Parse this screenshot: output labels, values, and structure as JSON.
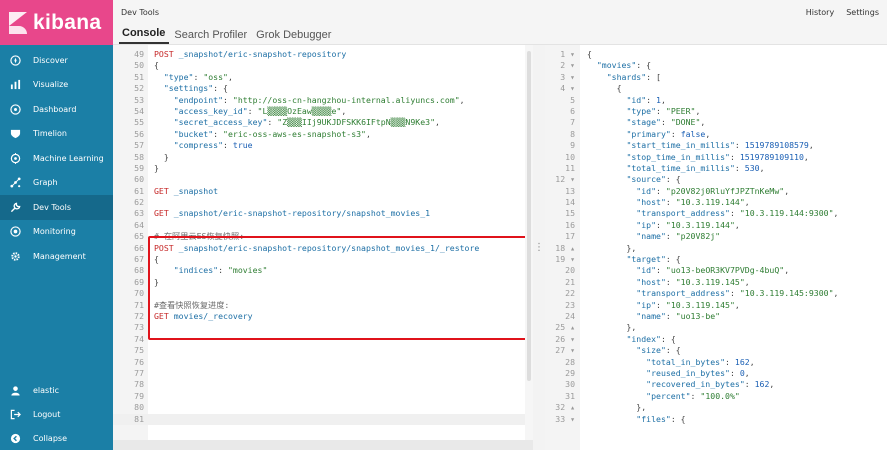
{
  "sidebar": {
    "brand": "kibana",
    "items": [
      {
        "label": "Discover",
        "icon": "compass-icon"
      },
      {
        "label": "Visualize",
        "icon": "bar-chart-icon"
      },
      {
        "label": "Dashboard",
        "icon": "dashboard-icon"
      },
      {
        "label": "Timelion",
        "icon": "shield-icon"
      },
      {
        "label": "Machine Learning",
        "icon": "machine-learning-icon"
      },
      {
        "label": "Graph",
        "icon": "graph-icon"
      },
      {
        "label": "Dev Tools",
        "icon": "wrench-icon"
      },
      {
        "label": "Monitoring",
        "icon": "monitoring-icon"
      },
      {
        "label": "Management",
        "icon": "gear-icon"
      }
    ],
    "bottom": [
      {
        "label": "elastic",
        "icon": "user-icon"
      },
      {
        "label": "Logout",
        "icon": "logout-icon"
      },
      {
        "label": "Collapse",
        "icon": "collapse-icon"
      }
    ]
  },
  "topbar": {
    "title": "Dev Tools",
    "history": "History",
    "settings": "Settings"
  },
  "tabs": [
    "Console",
    "Search Profiler",
    "Grok Debugger"
  ],
  "left_editor": {
    "lines": [
      {
        "n": "49",
        "t": "POST _snapshot/eric-snapshot-repository"
      },
      {
        "n": "50",
        "t": "{"
      },
      {
        "n": "51",
        "t": "  \"type\": \"oss\","
      },
      {
        "n": "52",
        "t": "  \"settings\": {"
      },
      {
        "n": "53",
        "t": "    \"endpoint\": \"http://oss-cn-hangzhou-internal.aliyuncs.com\","
      },
      {
        "n": "54",
        "t": "    \"access_key_id\": \"L▒▒▒▒OzEaw▒▒▒▒e\","
      },
      {
        "n": "55",
        "t": "    \"secret_access_key\": \"Z▒▒▒IIj9UKJDFSKK6IFtpN▒▒▒N9Ke3\","
      },
      {
        "n": "56",
        "t": "    \"bucket\": \"eric-oss-aws-es-snapshot-s3\","
      },
      {
        "n": "57",
        "t": "    \"compress\": true"
      },
      {
        "n": "58",
        "t": "  }"
      },
      {
        "n": "59",
        "t": "}"
      },
      {
        "n": "60",
        "t": ""
      },
      {
        "n": "61",
        "t": "GET _snapshot"
      },
      {
        "n": "62",
        "t": ""
      },
      {
        "n": "63",
        "t": "GET _snapshot/eric-snapshot-repository/snapshot_movies_1"
      },
      {
        "n": "64",
        "t": ""
      },
      {
        "n": "65",
        "t": "# 在阿里云ES恢复快照:"
      },
      {
        "n": "66",
        "t": "POST _snapshot/eric-snapshot-repository/snapshot_movies_1/_restore"
      },
      {
        "n": "67",
        "t": "{"
      },
      {
        "n": "68",
        "t": "    \"indices\": \"movies\""
      },
      {
        "n": "69",
        "t": "}"
      },
      {
        "n": "70",
        "t": ""
      },
      {
        "n": "71",
        "t": "#查看快照恢复进度:"
      },
      {
        "n": "72",
        "t": "GET movies/_recovery"
      },
      {
        "n": "73",
        "t": ""
      },
      {
        "n": "74",
        "t": ""
      },
      {
        "n": "75",
        "t": ""
      },
      {
        "n": "76",
        "t": ""
      },
      {
        "n": "77",
        "t": ""
      },
      {
        "n": "78",
        "t": ""
      },
      {
        "n": "79",
        "t": ""
      },
      {
        "n": "80",
        "t": ""
      },
      {
        "n": "81",
        "t": ""
      }
    ]
  },
  "right_editor": {
    "lines": [
      {
        "n": "1 ▾",
        "t": "{"
      },
      {
        "n": "2 ▾",
        "t": "  \"movies\": {"
      },
      {
        "n": "3 ▾",
        "t": "    \"shards\": ["
      },
      {
        "n": "4 ▾",
        "t": "      {"
      },
      {
        "n": "5",
        "t": "        \"id\": 1,"
      },
      {
        "n": "6",
        "t": "        \"type\": \"PEER\","
      },
      {
        "n": "7",
        "t": "        \"stage\": \"DONE\","
      },
      {
        "n": "8",
        "t": "        \"primary\": false,"
      },
      {
        "n": "9",
        "t": "        \"start_time_in_millis\": 1519789108579,"
      },
      {
        "n": "10",
        "t": "        \"stop_time_in_millis\": 1519789109110,"
      },
      {
        "n": "11",
        "t": "        \"total_time_in_millis\": 530,"
      },
      {
        "n": "12 ▾",
        "t": "        \"source\": {"
      },
      {
        "n": "13",
        "t": "          \"id\": \"p20V82j0RluYfJPZTnKeMw\","
      },
      {
        "n": "14",
        "t": "          \"host\": \"10.3.119.144\","
      },
      {
        "n": "15",
        "t": "          \"transport_address\": \"10.3.119.144:9300\","
      },
      {
        "n": "16",
        "t": "          \"ip\": \"10.3.119.144\","
      },
      {
        "n": "17",
        "t": "          \"name\": \"p20V82j\""
      },
      {
        "n": "18 ▴",
        "t": "        },"
      },
      {
        "n": "19 ▾",
        "t": "        \"target\": {"
      },
      {
        "n": "20",
        "t": "          \"id\": \"uo13-beOR3KV7PVDg-4buQ\","
      },
      {
        "n": "21",
        "t": "          \"host\": \"10.3.119.145\","
      },
      {
        "n": "22",
        "t": "          \"transport_address\": \"10.3.119.145:9300\","
      },
      {
        "n": "23",
        "t": "          \"ip\": \"10.3.119.145\","
      },
      {
        "n": "24",
        "t": "          \"name\": \"uo13-be\""
      },
      {
        "n": "25 ▴",
        "t": "        },"
      },
      {
        "n": "26 ▾",
        "t": "        \"index\": {"
      },
      {
        "n": "27 ▾",
        "t": "          \"size\": {"
      },
      {
        "n": "28",
        "t": "            \"total_in_bytes\": 162,"
      },
      {
        "n": "29",
        "t": "            \"reused_in_bytes\": 0,"
      },
      {
        "n": "30",
        "t": "            \"recovered_in_bytes\": 162,"
      },
      {
        "n": "31",
        "t": "            \"percent\": \"100.0%\""
      },
      {
        "n": "32 ▴",
        "t": "          },"
      },
      {
        "n": "33 ▾",
        "t": "          \"files\": {"
      }
    ]
  }
}
